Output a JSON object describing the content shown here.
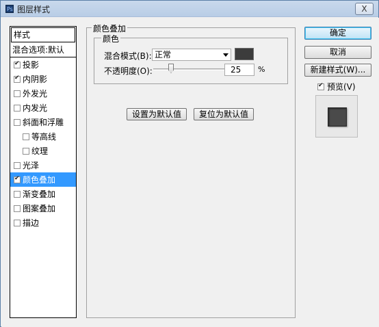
{
  "window": {
    "title": "图层样式",
    "close_glyph": "X"
  },
  "styles_panel": {
    "header": "样式",
    "blend_options": "混合选项:默认",
    "items": [
      {
        "label": "投影",
        "checked": true,
        "indent": false,
        "selected": false
      },
      {
        "label": "内阴影",
        "checked": true,
        "indent": false,
        "selected": false
      },
      {
        "label": "外发光",
        "checked": false,
        "indent": false,
        "selected": false
      },
      {
        "label": "内发光",
        "checked": false,
        "indent": false,
        "selected": false
      },
      {
        "label": "斜面和浮雕",
        "checked": false,
        "indent": false,
        "selected": false
      },
      {
        "label": "等高线",
        "checked": false,
        "indent": true,
        "selected": false
      },
      {
        "label": "纹理",
        "checked": false,
        "indent": true,
        "selected": false
      },
      {
        "label": "光泽",
        "checked": false,
        "indent": false,
        "selected": false
      },
      {
        "label": "颜色叠加",
        "checked": true,
        "indent": false,
        "selected": true
      },
      {
        "label": "渐变叠加",
        "checked": false,
        "indent": false,
        "selected": false
      },
      {
        "label": "图案叠加",
        "checked": false,
        "indent": false,
        "selected": false
      },
      {
        "label": "描边",
        "checked": false,
        "indent": false,
        "selected": false
      }
    ]
  },
  "color_overlay": {
    "group_title": "颜色叠加",
    "subgroup_title": "颜色",
    "blend_mode_label": "混合模式(B):",
    "blend_mode_value": "正常",
    "swatch_color": "#3c3c3c",
    "opacity_label": "不透明度(O):",
    "opacity_value": "25",
    "opacity_unit": "%",
    "opacity_fraction": 0.25,
    "set_default_button": "设置为默认值",
    "reset_default_button": "复位为默认值"
  },
  "actions": {
    "ok": "确定",
    "cancel": "取消",
    "new_style": "新建样式(W)...",
    "preview_label": "预览(V)",
    "preview_checked": true
  }
}
